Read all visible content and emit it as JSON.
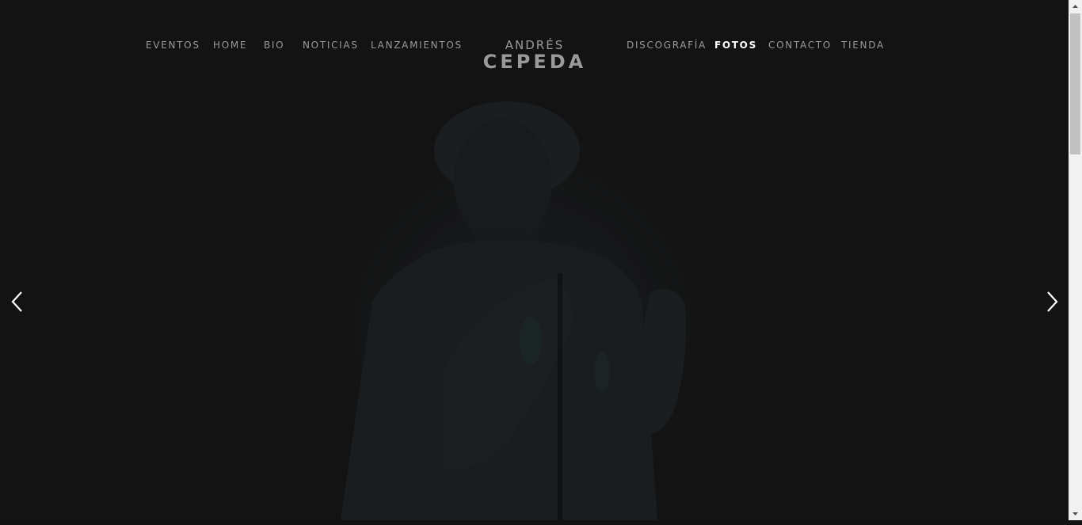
{
  "nav": {
    "left": [
      "EVENTOS",
      "HOME",
      "BIO",
      "NOTICIAS",
      "LANZAMIENTOS"
    ],
    "right": [
      "DISCOGRAFÍA",
      "FOTOS",
      "CONTACTO",
      "TIENDA"
    ],
    "active": "FOTOS"
  },
  "logo": {
    "top": "ANDRÉS",
    "bottom": "CEPEDA"
  },
  "slider": {
    "prev_icon": "chevron-left-icon",
    "next_icon": "chevron-right-icon"
  },
  "scrollbar": {
    "up_icon": "triangle-up-icon",
    "down_icon": "triangle-down-icon"
  },
  "colors": {
    "background": "#131313",
    "nav_text": "#9a9a9a",
    "nav_active": "#ffffff"
  }
}
